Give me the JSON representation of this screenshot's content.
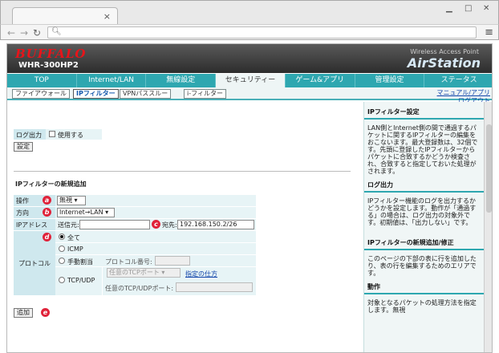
{
  "browser": {
    "address": ""
  },
  "header": {
    "brand": "BUFFALO",
    "model": "WHR-300HP2",
    "product_sub": "Wireless Access Point",
    "product": "AirStation"
  },
  "tabs": [
    "TOP",
    "Internet/LAN",
    "無線設定",
    "セキュリティー",
    "ゲーム&アプリ",
    "管理設定",
    "ステータス"
  ],
  "subnav": {
    "items": [
      "ファイアウォール",
      "IPフィルター",
      "VPNパススルー",
      "i-フィルター"
    ],
    "manual": "マニュアル/アプリ",
    "logout": "ログアウト"
  },
  "log": {
    "label": "ログ出力",
    "checkbox_label": "使用する",
    "set_button": "設定"
  },
  "new_filter": {
    "title": "IPフィルターの新規追加",
    "op_label": "操作",
    "op_value": "無視",
    "dir_label": "方向",
    "dir_value": "Internet→LAN",
    "ip_label": "IPアドレス",
    "src_label": "送信元:",
    "src_value": "",
    "dst_label": "宛先:",
    "dst_value": "192.168.150.2/26",
    "protocol_label": "プロトコル",
    "proto_all": "全て",
    "proto_icmp": "ICMP",
    "proto_manual": "手動割当",
    "proto_num_label": "プロトコル番号:",
    "proto_tcpudp": "TCP/UDP",
    "port_select": "任意のTCPポート",
    "howto": "指定の仕方",
    "port_label": "任意のTCP/UDPポート:",
    "add_button": "追加",
    "markers": [
      "a",
      "b",
      "c",
      "d",
      "e"
    ]
  },
  "help": {
    "h1": "IPフィルター設定",
    "t1": "LAN側とInternet側の間で通過するパケットに関するIPフィルターの編集をおこないます。最大登録数は、32個です。先頭に登録したIPフィルターからパケットに合致するかどうか検査され、合致すると指定しておいた処理がされます。",
    "h2": "ログ出力",
    "t2": "IPフィルター機能のログを出力するかどうかを設定します。動作が「通過する」の場合は、ログ出力の対象外です。初期値は、「出力しない」です。",
    "h3": "IPフィルターの新規追加/修正",
    "t3": "このページの下部の表に行を追加したり、表の行を編集するためのエリアです。",
    "h4": "動作",
    "t4": "対象となるパケットの処理方法を指定します。無視"
  },
  "colors": {
    "tab_bar": "#2ea7b0",
    "brand": "#e8141a",
    "marker": "#e0233a"
  }
}
